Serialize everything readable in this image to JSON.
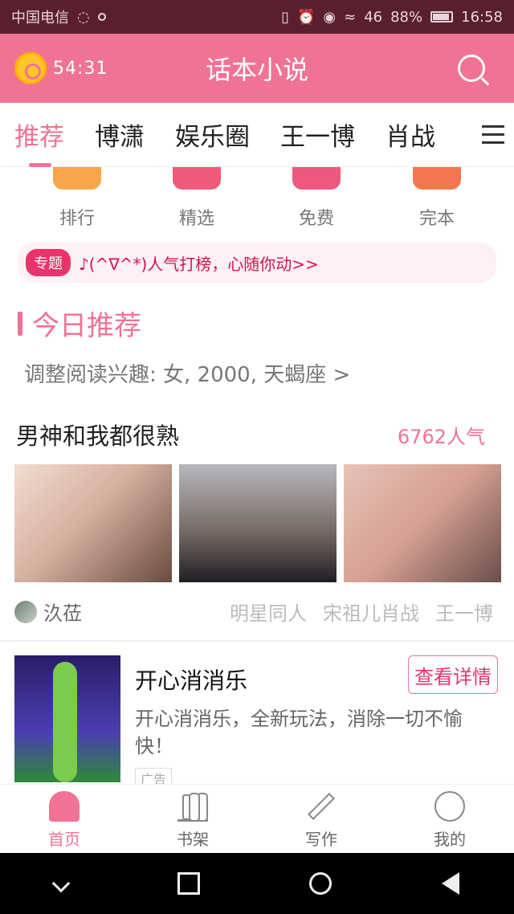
{
  "status_bar": {
    "carrier": "中国电信",
    "battery": "88%",
    "time": "16:58",
    "signal": "46"
  },
  "appbar": {
    "timer": "54:31",
    "title": "话本小说",
    "accent": "#f07394"
  },
  "tabs": [
    "推荐",
    "博潇",
    "娱乐圈",
    "王一博",
    "肖战"
  ],
  "quick_entries": [
    {
      "label": "排行",
      "color": "#f8a64a"
    },
    {
      "label": "精选",
      "color": "#f05a7a"
    },
    {
      "label": "免费",
      "color": "#f0577c"
    },
    {
      "label": "完本",
      "color": "#f3774e"
    }
  ],
  "topic": {
    "badge": "专题",
    "text": "♪(^∇^*)人气打榜，心随你动>>"
  },
  "section": {
    "title": "今日推荐",
    "interest": "调整阅读兴趣: 女, 2000, 天蝎座 >"
  },
  "novel": {
    "title": "男神和我都很熟",
    "popularity": "6762人气",
    "author": "汣莅",
    "tags": [
      "明星同人",
      "宋祖儿肖战",
      "王一博"
    ]
  },
  "ad": {
    "title": "开心消消乐",
    "button": "查看详情",
    "description": "开心消消乐，全新玩法，消除一切不愉快！",
    "label": "广告"
  },
  "bottom_nav": [
    "首页",
    "书架",
    "写作",
    "我的"
  ]
}
